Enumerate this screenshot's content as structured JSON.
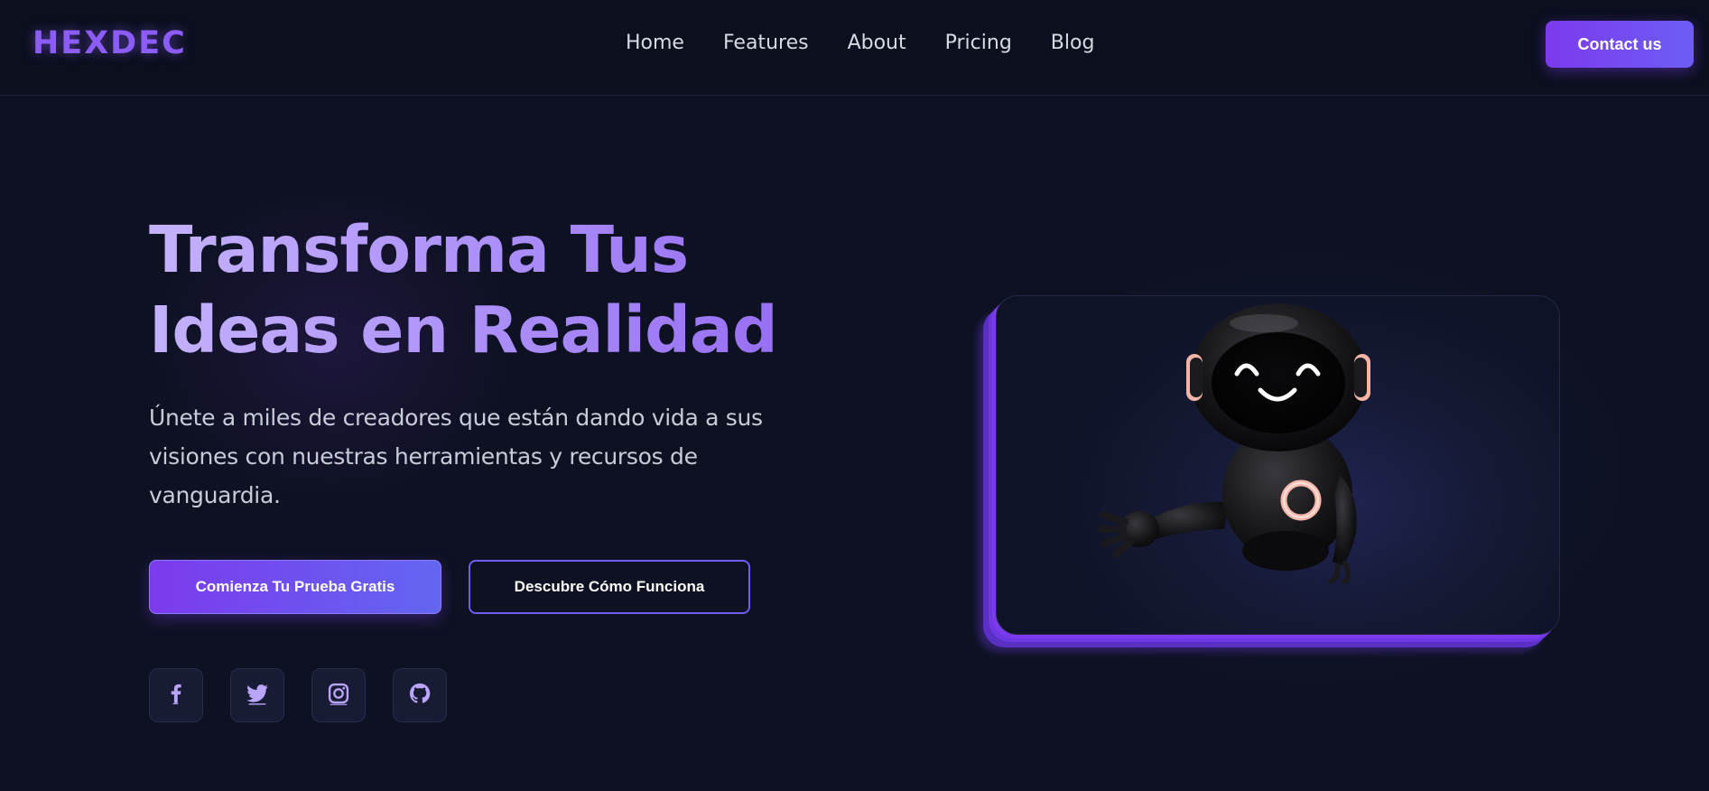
{
  "navbar": {
    "logo": "HEXDEC",
    "links": [
      "Home",
      "Features",
      "About",
      "Pricing",
      "Blog"
    ],
    "contact_label": "Contact us"
  },
  "hero": {
    "title_line1": "Transforma Tus",
    "title_line2": "Ideas en Realidad",
    "subtitle": "Únete a miles de creadores que están dando vida a sus visiones con nuestras herramientas y recursos de vanguardia.",
    "primary_cta": "Comienza Tu Prueba Gratis",
    "secondary_cta": "Descubre Cómo Funciona"
  },
  "socials": [
    {
      "icon": "facebook-icon"
    },
    {
      "icon": "twitter-icon"
    },
    {
      "icon": "instagram-icon"
    },
    {
      "icon": "github-icon"
    }
  ],
  "illustration": {
    "icon": "robot-illustration"
  },
  "colors": {
    "background": "#0d1122",
    "accent": "#7c3aed",
    "accent_secondary": "#6366f1",
    "title_gradient_start": "#c4b2fb",
    "title_gradient_end": "#9368f2"
  }
}
